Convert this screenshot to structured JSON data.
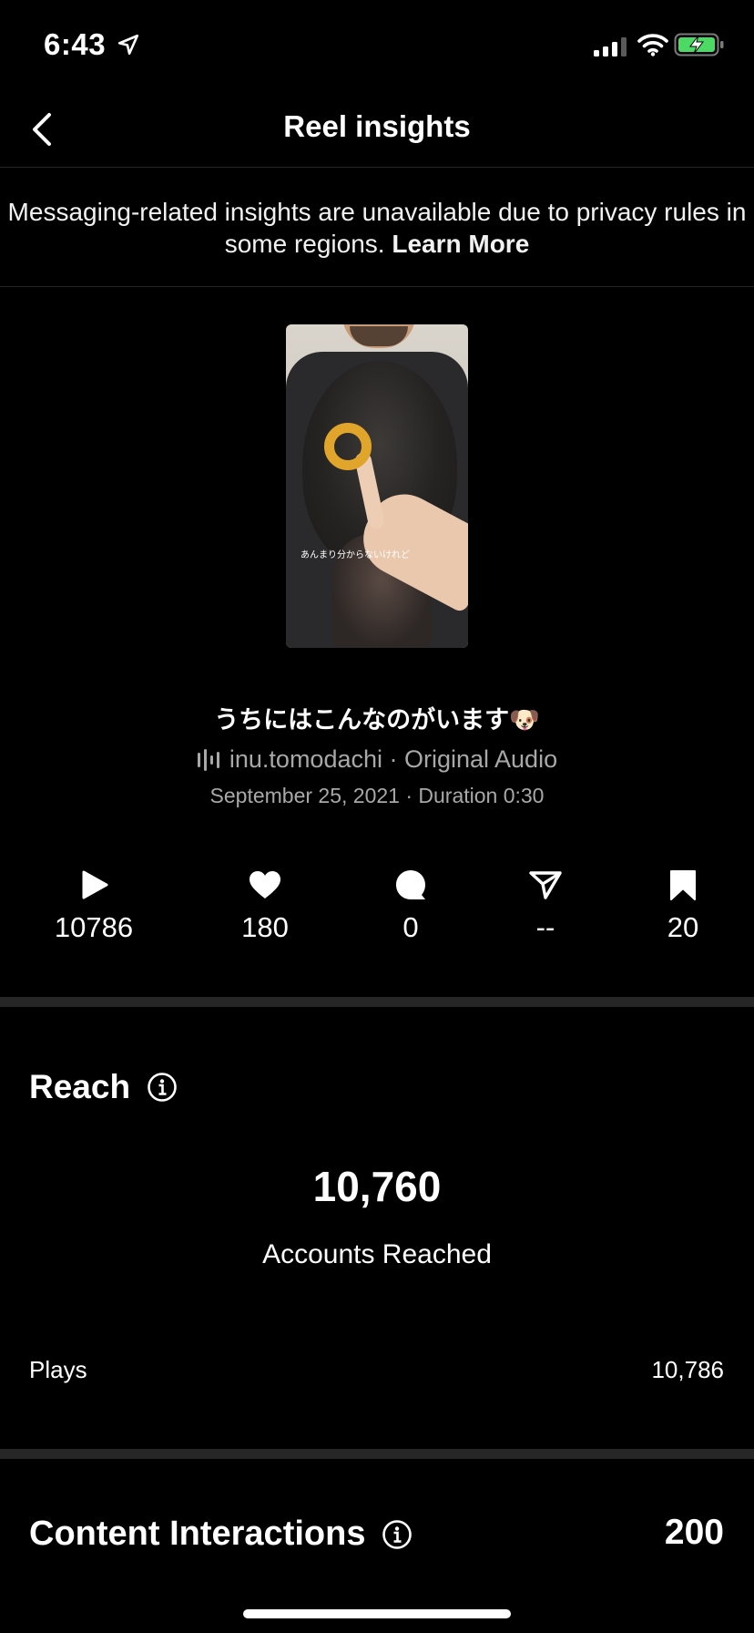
{
  "status_bar": {
    "time": "6:43"
  },
  "nav": {
    "title": "Reel insights"
  },
  "notice": {
    "text": "Messaging-related insights are unavailable due to privacy rules in some regions. ",
    "link": "Learn More"
  },
  "thumbnail": {
    "caption": "あんまり分からないけれど"
  },
  "reel": {
    "title": "うちにはこんなのがいます🐶",
    "audio": "inu.tomodachi · Original Audio",
    "date": "September 25, 2021 · Duration 0:30"
  },
  "stats": {
    "plays": "10786",
    "likes": "180",
    "comments": "0",
    "shares": "--",
    "saves": "20"
  },
  "reach": {
    "heading": "Reach",
    "accounts_reached": "10,760",
    "accounts_label": "Accounts Reached",
    "plays_label": "Plays",
    "plays_value": "10,786"
  },
  "content_interactions": {
    "heading": "Content Interactions",
    "value": "200"
  }
}
